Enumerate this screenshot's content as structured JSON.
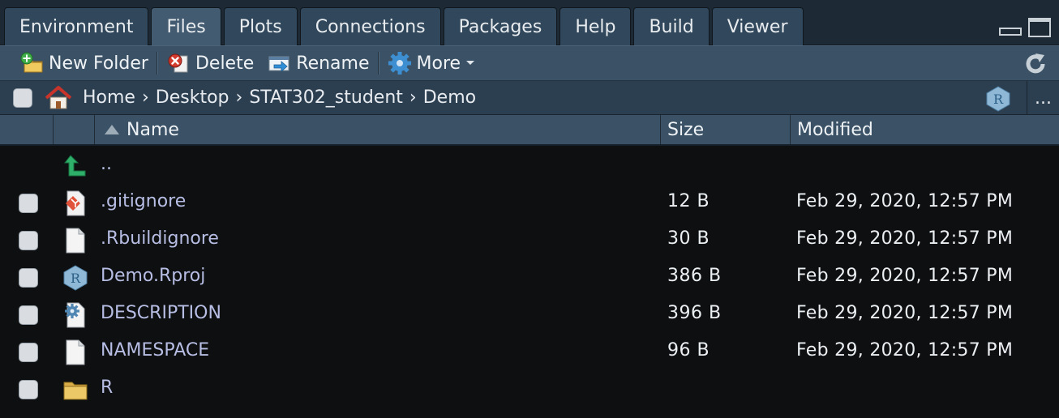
{
  "tabs": [
    {
      "label": "Environment",
      "active": false
    },
    {
      "label": "Files",
      "active": true
    },
    {
      "label": "Plots",
      "active": false
    },
    {
      "label": "Connections",
      "active": false
    },
    {
      "label": "Packages",
      "active": false
    },
    {
      "label": "Help",
      "active": false
    },
    {
      "label": "Build",
      "active": false
    },
    {
      "label": "Viewer",
      "active": false
    }
  ],
  "toolbar": {
    "new_folder": "New Folder",
    "delete": "Delete",
    "rename": "Rename",
    "more": "More"
  },
  "breadcrumb": [
    "Home",
    "Desktop",
    "STAT302_student",
    "Demo"
  ],
  "breadcrumb_more": "...",
  "columns": {
    "name": "Name",
    "size": "Size",
    "modified": "Modified"
  },
  "files": [
    {
      "name": "..",
      "size": "",
      "modified": "",
      "icon": "parent-folder-icon"
    },
    {
      "name": ".gitignore",
      "size": "12 B",
      "modified": "Feb 29, 2020, 12:57 PM",
      "icon": "git-file-icon"
    },
    {
      "name": ".Rbuildignore",
      "size": "30 B",
      "modified": "Feb 29, 2020, 12:57 PM",
      "icon": "text-file-icon"
    },
    {
      "name": "Demo.Rproj",
      "size": "386 B",
      "modified": "Feb 29, 2020, 12:57 PM",
      "icon": "rproj-file-icon"
    },
    {
      "name": "DESCRIPTION",
      "size": "396 B",
      "modified": "Feb 29, 2020, 12:57 PM",
      "icon": "config-file-icon"
    },
    {
      "name": "NAMESPACE",
      "size": "96 B",
      "modified": "Feb 29, 2020, 12:57 PM",
      "icon": "text-file-icon"
    },
    {
      "name": "R",
      "size": "",
      "modified": "",
      "icon": "folder-icon"
    }
  ],
  "colors": {
    "background": "#0d0f11",
    "toolbar": "#3a5166",
    "tab_active": "#435b71",
    "file_name": "#b7bde3"
  }
}
